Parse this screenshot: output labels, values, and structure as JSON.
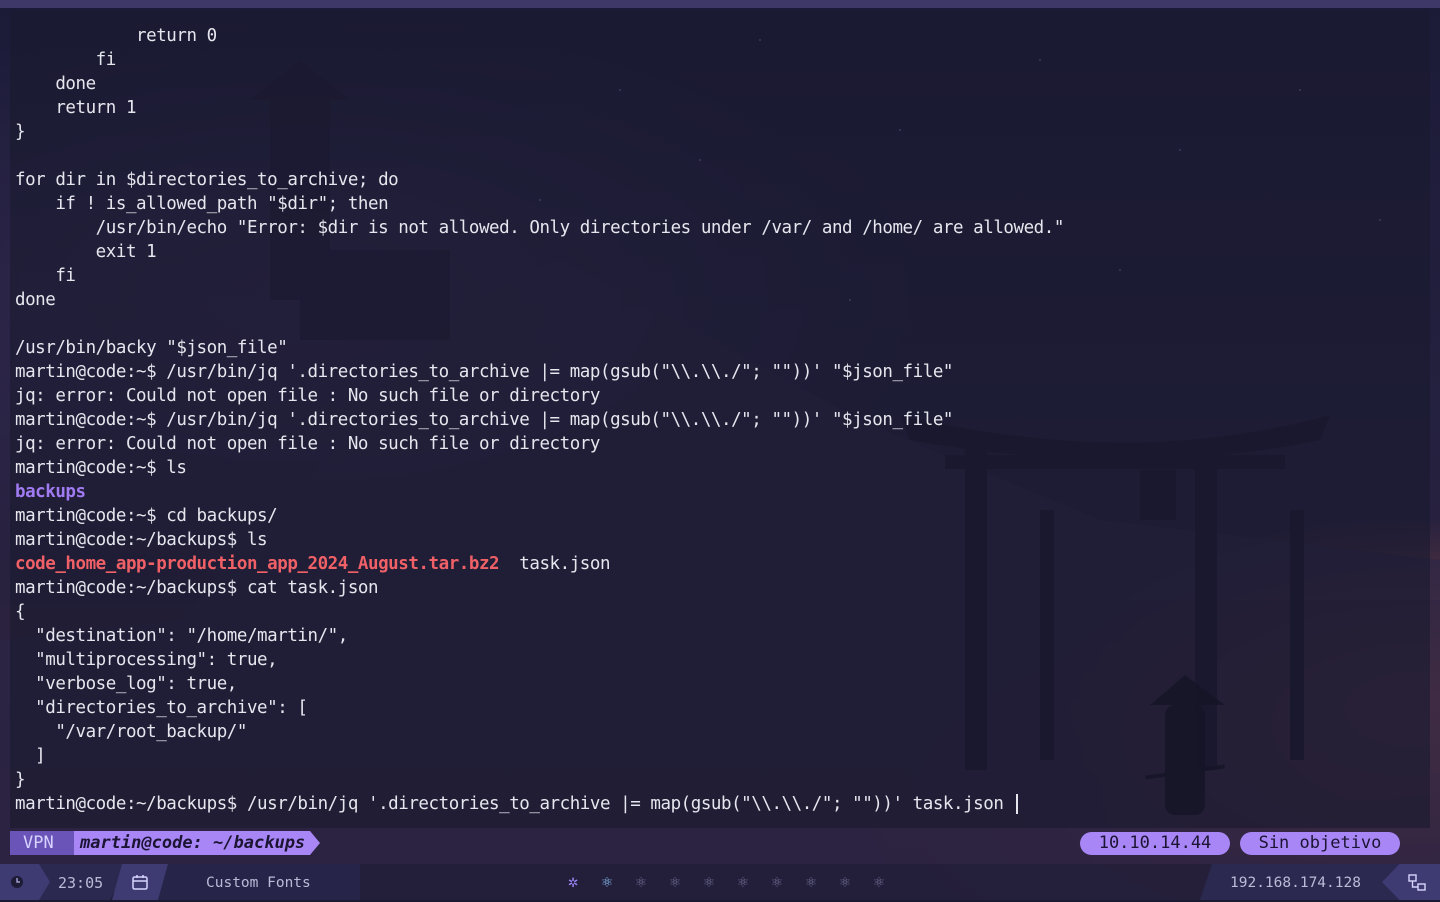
{
  "terminal": {
    "lines": [
      "            return 0",
      "        fi",
      "    done",
      "    return 1",
      "}",
      "",
      "for dir in $directories_to_archive; do",
      "    if ! is_allowed_path \"$dir\"; then",
      "        /usr/bin/echo \"Error: $dir is not allowed. Only directories under /var/ and /home/ are allowed.\"",
      "        exit 1",
      "    fi",
      "done",
      "",
      "/usr/bin/backy \"$json_file\"",
      "martin@code:~$ /usr/bin/jq '.directories_to_archive |= map(gsub(\"\\\\.\\\\./\"; \"\"))' \"$json_file\"",
      "jq: error: Could not open file : No such file or directory",
      "martin@code:~$ /usr/bin/jq '.directories_to_archive |= map(gsub(\"\\\\.\\\\./\"; \"\"))' \"$json_file\"",
      "jq: error: Could not open file : No such file or directory",
      "martin@code:~$ ls"
    ],
    "ls_dir": "backups",
    "line_cd": "martin@code:~$ cd backups/",
    "line_ls2": "martin@code:~/backups$ ls",
    "ls2_archive": "code_home_app-production_app_2024_August.tar.bz2",
    "ls2_file": "  task.json",
    "lines2": [
      "martin@code:~/backups$ cat task.json",
      "{",
      "  \"destination\": \"/home/martin/\",",
      "  \"multiprocessing\": true,",
      "  \"verbose_log\": true,",
      "  \"directories_to_archive\": [",
      "    \"/var/root_backup/\"",
      "  ]",
      "}"
    ],
    "prompt_line": "martin@code:~/backups$ /usr/bin/jq '.directories_to_archive |= map(gsub(\"\\\\.\\\\./\"; \"\"))' task.json "
  },
  "statusline": {
    "vpn": "VPN",
    "path": "martin@code: ~/backups",
    "ip": "10.10.14.44",
    "target": "Sin objetivo"
  },
  "bottombar": {
    "time": "23:05",
    "fonts_label": "Custom Fonts",
    "workspaces": [
      "✲",
      "⚛",
      "⚛",
      "⚛",
      "⚛",
      "⚛",
      "⚛",
      "⚛",
      "⚛",
      "⚛"
    ],
    "net_ip": "192.168.174.128"
  },
  "colors": {
    "accent": "#a886f5",
    "accent_dark": "#6a54b8",
    "directory": "#a07bf2",
    "archive": "#f06067"
  }
}
